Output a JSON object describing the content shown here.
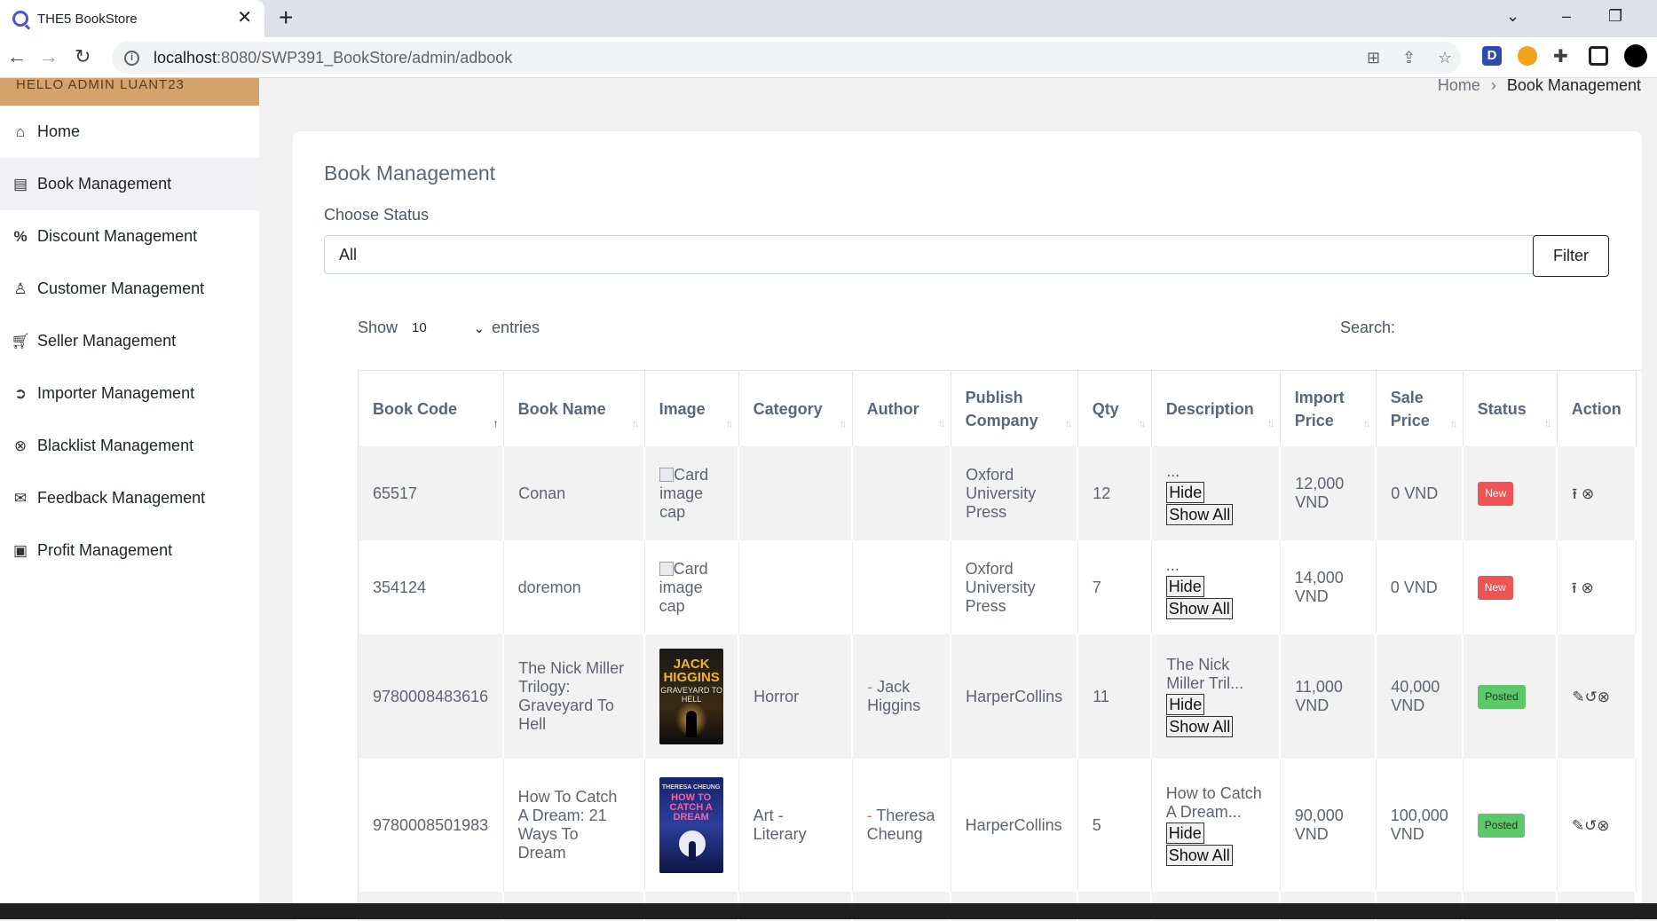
{
  "browser": {
    "tab_title": "THE5 BookStore",
    "tab_close": "✕",
    "new_tab": "+",
    "url_host": "localhost",
    "url_path": ":8080/SWP391_BookStore/admin/adbook"
  },
  "sidebar": {
    "hello": "HELLO ADMIN LUANT23",
    "items": [
      {
        "label": "Home",
        "icon": "home-icon"
      },
      {
        "label": "Book Management",
        "icon": "book-icon"
      },
      {
        "label": "Discount Management",
        "icon": "percent-icon"
      },
      {
        "label": "Customer Management",
        "icon": "user-icon"
      },
      {
        "label": "Seller Management",
        "icon": "cart-icon"
      },
      {
        "label": "Importer Management",
        "icon": "arrow-circle-icon"
      },
      {
        "label": "Blacklist Management",
        "icon": "x-circle-icon"
      },
      {
        "label": "Feedback Management",
        "icon": "envelope-icon"
      },
      {
        "label": "Profit Management",
        "icon": "money-icon"
      }
    ]
  },
  "breadcrumb": {
    "home": "Home",
    "sep": "›",
    "current": "Book Management"
  },
  "main": {
    "title": "Book Management",
    "status_label": "Choose Status",
    "status_value": "All",
    "filter_label": "Filter",
    "show_label": "Show",
    "entries_value": "10",
    "entries_label": "entries",
    "search_label": "Search:"
  },
  "table": {
    "headers": [
      "Book Code",
      "Book Name",
      "Image",
      "Category",
      "Author",
      "Publish Company",
      "Qty",
      "Description",
      "Import Price",
      "Sale Price",
      "Status",
      "Action"
    ],
    "headers_lines": [
      [
        "Book Code"
      ],
      [
        "Book Name"
      ],
      [
        "Image"
      ],
      [
        "Category"
      ],
      [
        "Author"
      ],
      [
        "Publish",
        "Company"
      ],
      [
        "Qty"
      ],
      [
        "Description"
      ],
      [
        "Import",
        "Price"
      ],
      [
        "Sale",
        "Price"
      ],
      [
        "Status"
      ],
      [
        "Action"
      ]
    ],
    "hide_label": "Hide",
    "show_all_label": "Show All",
    "img_alt": "Card image cap",
    "rows": [
      {
        "code": "65517",
        "name": "Conan",
        "image": "",
        "category": "",
        "author": "",
        "company": "Oxford University Press",
        "qty": "12",
        "desc": "...",
        "import": "12,000 VND",
        "sale": "0 VND",
        "status": "New"
      },
      {
        "code": "354124",
        "name": "doremon",
        "image": "",
        "category": "",
        "author": "",
        "company": "Oxford University Press",
        "qty": "7",
        "desc": "...",
        "import": "14,000 VND",
        "sale": "0 VND",
        "status": "New"
      },
      {
        "code": "9780008483616",
        "name": "The Nick Miller Trilogy: Graveyard To Hell",
        "image": "cover-jack-higgins",
        "category": "Horror",
        "author": "Jack Higgins",
        "company": "HarperCollins",
        "qty": "11",
        "desc": "The Nick Miller Tril...",
        "import": "11,000 VND",
        "sale": "40,000 VND",
        "status": "Posted"
      },
      {
        "code": "9780008501983",
        "name": "How To Catch A Dream: 21 Ways To Dream",
        "image": "cover-how-to-catch-a-dream",
        "category": "Art - Literary",
        "author": "Theresa Cheung",
        "company": "HarperCollins",
        "qty": "5",
        "desc": "How to Catch A Dream...",
        "import": "90,000 VND",
        "sale": "100,000 VND",
        "status": "Posted"
      }
    ],
    "cover1": {
      "author": "JACK HIGGINS",
      "title": "GRAVEYARD TO HELL"
    },
    "cover2": {
      "author": "THERESA CHEUNG",
      "title": "HOW TO CATCH A DREAM"
    }
  },
  "colors": {
    "new_badge": "#ef5353",
    "posted_badge": "#5cc86a",
    "hello_bar": "#d4a26a"
  }
}
